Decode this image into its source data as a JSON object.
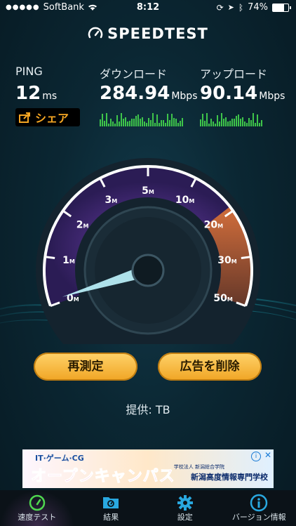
{
  "status": {
    "carrier": "SoftBank",
    "time": "8:12",
    "battery": "74%"
  },
  "header": {
    "title": "SPEEDTEST"
  },
  "stats": {
    "ping": {
      "label": "PING",
      "value": "12",
      "unit": "ms"
    },
    "download": {
      "label": "ダウンロード",
      "value": "284.94",
      "unit": "Mbps"
    },
    "upload": {
      "label": "アップロード",
      "value": "90.14",
      "unit": "Mbps"
    }
  },
  "share_label": "シェア",
  "gauge": {
    "ticks": [
      {
        "label": "0",
        "unit": "M"
      },
      {
        "label": "1",
        "unit": "M"
      },
      {
        "label": "2",
        "unit": "M"
      },
      {
        "label": "3",
        "unit": "M"
      },
      {
        "label": "5",
        "unit": "M"
      },
      {
        "label": "10",
        "unit": "M"
      },
      {
        "label": "20",
        "unit": "M"
      },
      {
        "label": "30",
        "unit": "M"
      },
      {
        "label": "50",
        "unit": "M"
      }
    ]
  },
  "buttons": {
    "retest": "再測定",
    "remove_ads": "広告を削除"
  },
  "provider": "提供: TB",
  "ad": {
    "top": "IT·ゲーム·CG",
    "main": "オープンキャンパス",
    "school_sub": "学校法人 新潟総合学院",
    "school": "新潟高度情報専門学校"
  },
  "tabs": [
    {
      "label": "速度テスト",
      "icon": "speedometer-icon",
      "active": true
    },
    {
      "label": "結果",
      "icon": "results-folder-icon",
      "active": false
    },
    {
      "label": "設定",
      "icon": "gear-icon",
      "active": false
    },
    {
      "label": "バージョン情報",
      "icon": "info-icon",
      "active": false
    }
  ]
}
